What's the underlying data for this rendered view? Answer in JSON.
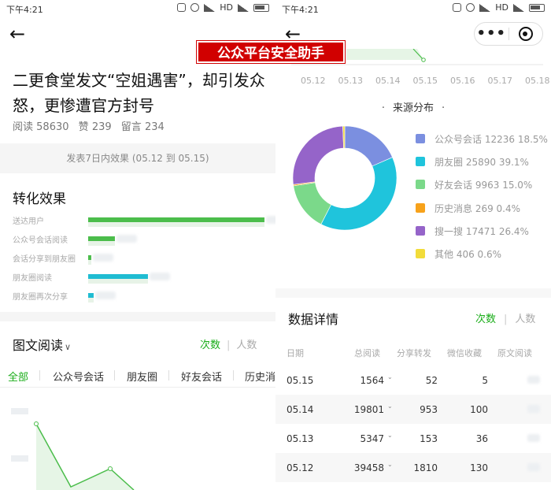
{
  "status": {
    "time": "下午4:21",
    "network": "HD"
  },
  "watermark": "公众平台安全助手",
  "article": {
    "title": "二更食堂发文“空姐遇害”，却引发众怒，更惨遭官方封号",
    "reads_label": "阅读",
    "reads": "58630",
    "likes_label": "赞",
    "likes": "239",
    "comments_label": "留言",
    "comments": "234",
    "period": "发表7日内效果 (05.12 到 05.15)"
  },
  "conversion": {
    "title": "转化效果",
    "rows": [
      {
        "label": "送达用户",
        "color": "#4bbd4b",
        "fraction": 1.0
      },
      {
        "label": "公众号会话阅读",
        "color": "#4bbd4b",
        "fraction": 0.15
      },
      {
        "label": "会话分享到朋友圈",
        "color": "#4bbd4b",
        "fraction": 0.02
      },
      {
        "label": "朋友圈阅读",
        "color": "#1fbcd2",
        "fraction": 0.34
      },
      {
        "label": "朋友圈再次分享",
        "color": "#1fbcd2",
        "fraction": 0.03
      }
    ]
  },
  "reading": {
    "title": "图文阅读",
    "toggle_on": "次数",
    "toggle_off": "人数",
    "tabs": [
      "全部",
      "公众号会话",
      "朋友圈",
      "好友会话",
      "历史消息"
    ],
    "active_tab": 0
  },
  "trend_x": [
    "05.12",
    "05.13",
    "05.14",
    "05.15",
    "05.16",
    "05.17",
    "05.18"
  ],
  "chart_data": {
    "type": "pie",
    "title": "来源分布",
    "categories": [
      "公众号会话",
      "朋友圈",
      "好友会话",
      "历史消息",
      "搜一搜",
      "其他"
    ],
    "values": [
      12236,
      25890,
      9963,
      269,
      17471,
      406
    ],
    "percent_labels": [
      "18.5%",
      "39.1%",
      "15.0%",
      "0.4%",
      "26.4%",
      "0.6%"
    ],
    "colors": [
      "#7b8fe0",
      "#1fc4dc",
      "#7bd98a",
      "#f7a21b",
      "#9564c9",
      "#f2dc3a"
    ]
  },
  "details": {
    "title": "数据详情",
    "toggle_on": "次数",
    "toggle_off": "人数",
    "headers": [
      "日期",
      "总阅读",
      "分享转发",
      "微信收藏",
      "原文阅读"
    ],
    "rows": [
      [
        "05.15",
        "1564",
        "52",
        "5"
      ],
      [
        "05.14",
        "19801",
        "953",
        "100"
      ],
      [
        "05.13",
        "5347",
        "153",
        "36"
      ],
      [
        "05.12",
        "39458",
        "1810",
        "130"
      ]
    ]
  }
}
